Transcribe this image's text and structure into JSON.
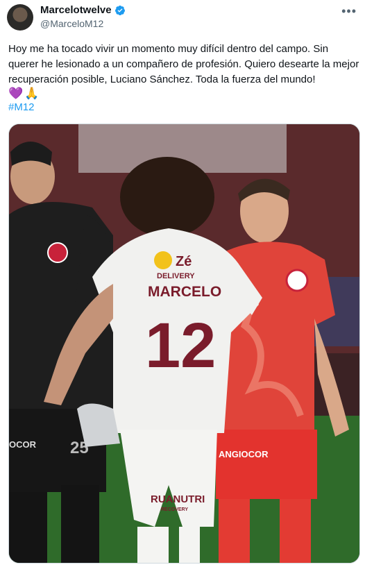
{
  "author": {
    "display_name": "Marcelotwelve",
    "handle": "@MarceloM12",
    "verified": true,
    "avatar_icon": "profile-photo"
  },
  "tweet": {
    "text": "Hoy me ha tocado vivir un momento muy difícil dentro del campo. Sin querer he lesionado a un compañero de profesión. Quiero desearte la mejor recuperación posible, Luciano Sánchez. Toda la fuerza del mundo!",
    "emojis": [
      "💜",
      "🙏"
    ],
    "hashtag": "#M12"
  },
  "media": {
    "jersey_sponsor": "Zé",
    "jersey_sponsor_sub": "DELIVERY",
    "jersey_name": "MARCELO",
    "jersey_number": "12",
    "shorts_sponsor": "RUANUTRI",
    "shorts_sponsor_sub": "RECOVERY",
    "red_shorts_sponsor": "ANGIOCOR",
    "keeper_shorts_sponsor": "OCOR",
    "keeper_number": "25"
  },
  "colors": {
    "link": "#1d9bf0",
    "secondary_text": "#536471",
    "jersey_white": "#f1f1ef",
    "jersey_maroon": "#7a1c2b",
    "red_kit": "#e0443a",
    "keeper_black": "#1e1e1e",
    "pitch": "#2f6b2a"
  }
}
